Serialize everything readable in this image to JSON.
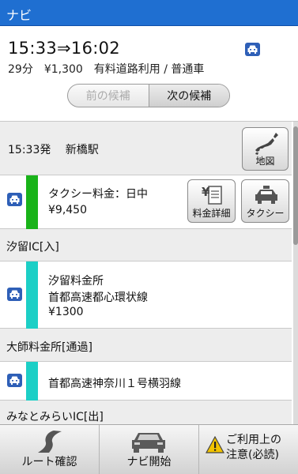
{
  "titlebar": {
    "title": "ナビ"
  },
  "summary": {
    "times": "15:33⇒16:02",
    "details": "29分　¥1,300　有料道路利用 / 普通車",
    "prev_label": "前の候補",
    "next_label": "次の候補"
  },
  "departure": {
    "text": "15:33発　 新橋駅",
    "map_label": "地図"
  },
  "taxi": {
    "title": "タクシー料金：日中",
    "price": "¥9,450",
    "stripe_color": "#19b319",
    "fare_label": "料金詳細",
    "taxi_label": "タクシー"
  },
  "waypoint1": {
    "label": "汐留IC[入]"
  },
  "segment1": {
    "line1": "汐留料金所",
    "line2": "首都高速都心環状線",
    "line3": "¥1300",
    "stripe_color": "#1ccfc6"
  },
  "waypoint2": {
    "label": "大師料金所[通過]"
  },
  "segment2": {
    "line1": "首都高速神奈川１号横羽線",
    "stripe_color": "#1ccfc6"
  },
  "waypoint3": {
    "label": "みなとみらいIC[出]"
  },
  "bottom": {
    "route_label": "ルート確認",
    "navi_label": "ナビ開始",
    "caution_line1": "ご利用上の",
    "caution_line2": "注意(必読)"
  }
}
